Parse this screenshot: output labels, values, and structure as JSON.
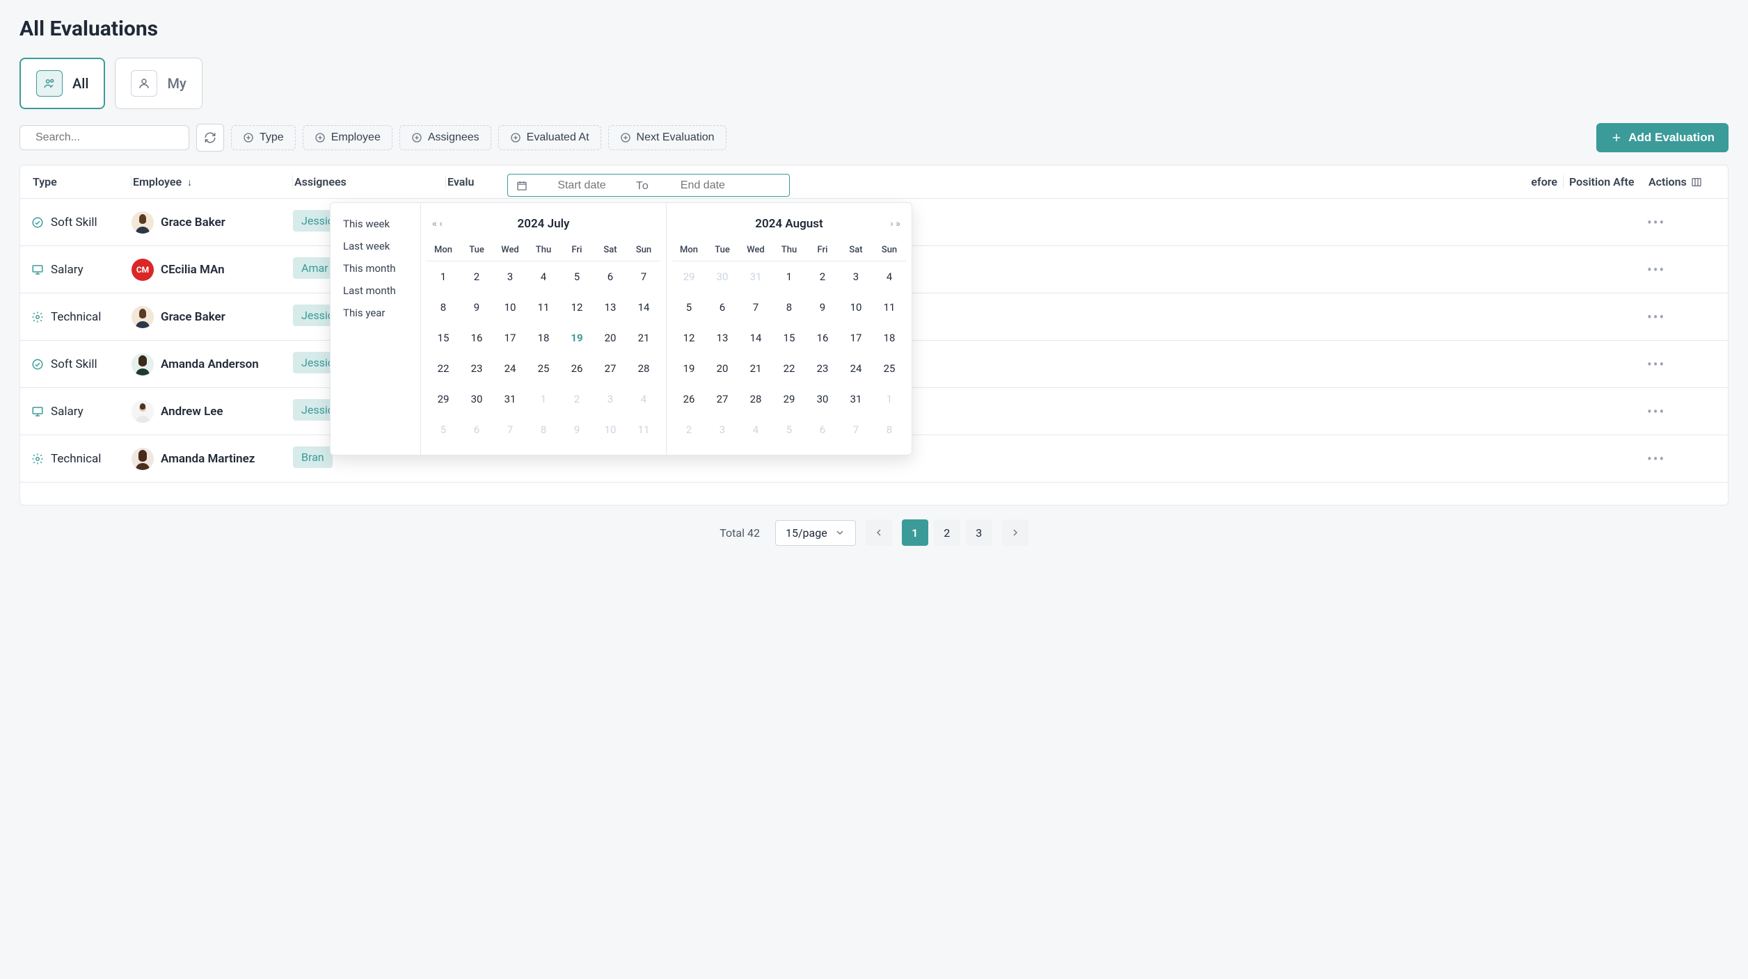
{
  "page_title": "All Evaluations",
  "tabs": {
    "all": "All",
    "my": "My"
  },
  "search": {
    "placeholder": "Search..."
  },
  "filters": {
    "type": "Type",
    "employee": "Employee",
    "assignees": "Assignees",
    "evaluated_at": "Evaluated At",
    "next_evaluation": "Next Evaluation"
  },
  "add_button": "Add Evaluation",
  "columns": {
    "type": "Type",
    "employee": "Employee",
    "assignees": "Assignees",
    "evaluated_at": "Evaluated At",
    "position_before": "Position Before",
    "position_after": "Position After",
    "actions": "Actions"
  },
  "column_cutoffs": {
    "evaluated_at": "Evalu",
    "position_before": "efore",
    "position_after": "Position Afte"
  },
  "rows": [
    {
      "type": "Soft Skill",
      "type_icon": "check-circle",
      "employee": "Grace Baker",
      "avatar": "photo-f1",
      "assignee": "Jessica",
      "assignee_cut": "Jessic"
    },
    {
      "type": "Salary",
      "type_icon": "monitor",
      "employee": "CEcilia MAn",
      "avatar": "initials",
      "initials": "CM",
      "assignee": "Amar",
      "assignee_cut": "Amar"
    },
    {
      "type": "Technical",
      "type_icon": "gear",
      "employee": "Grace Baker",
      "avatar": "photo-f1",
      "assignee": "Jessica",
      "assignee_cut": "Jessic"
    },
    {
      "type": "Soft Skill",
      "type_icon": "check-circle",
      "employee": "Amanda Anderson",
      "avatar": "photo-f2",
      "assignee": "Jessica",
      "assignee_cut": "Jessic"
    },
    {
      "type": "Salary",
      "type_icon": "monitor",
      "employee": "Andrew Lee",
      "avatar": "photo-m1",
      "assignee": "Jessica",
      "assignee_cut": "Jessic"
    },
    {
      "type": "Technical",
      "type_icon": "gear",
      "employee": "Amanda Martinez",
      "avatar": "photo-f3",
      "assignee": "Bran",
      "assignee_cut": "Bran"
    }
  ],
  "date_picker": {
    "start_placeholder": "Start date",
    "end_placeholder": "End date",
    "to": "To",
    "quick": [
      "This week",
      "Last week",
      "This month",
      "Last month",
      "This year"
    ],
    "left": {
      "title": "2024 July",
      "weekdays": [
        "Mon",
        "Tue",
        "Wed",
        "Thu",
        "Fri",
        "Sat",
        "Sun"
      ],
      "today": 19,
      "weeks": [
        [
          {
            "d": 1
          },
          {
            "d": 2
          },
          {
            "d": 3
          },
          {
            "d": 4
          },
          {
            "d": 5
          },
          {
            "d": 6
          },
          {
            "d": 7
          }
        ],
        [
          {
            "d": 8
          },
          {
            "d": 9
          },
          {
            "d": 10
          },
          {
            "d": 11
          },
          {
            "d": 12
          },
          {
            "d": 13
          },
          {
            "d": 14
          }
        ],
        [
          {
            "d": 15
          },
          {
            "d": 16
          },
          {
            "d": 17
          },
          {
            "d": 18
          },
          {
            "d": 19,
            "today": true
          },
          {
            "d": 20
          },
          {
            "d": 21
          }
        ],
        [
          {
            "d": 22
          },
          {
            "d": 23
          },
          {
            "d": 24
          },
          {
            "d": 25
          },
          {
            "d": 26
          },
          {
            "d": 27
          },
          {
            "d": 28
          }
        ],
        [
          {
            "d": 29
          },
          {
            "d": 30
          },
          {
            "d": 31
          },
          {
            "d": 1,
            "muted": true
          },
          {
            "d": 2,
            "muted": true
          },
          {
            "d": 3,
            "muted": true
          },
          {
            "d": 4,
            "muted": true
          }
        ],
        [
          {
            "d": 5,
            "muted": true
          },
          {
            "d": 6,
            "muted": true
          },
          {
            "d": 7,
            "muted": true
          },
          {
            "d": 8,
            "muted": true
          },
          {
            "d": 9,
            "muted": true
          },
          {
            "d": 10,
            "muted": true
          },
          {
            "d": 11,
            "muted": true
          }
        ]
      ]
    },
    "right": {
      "title": "2024 August",
      "weekdays": [
        "Mon",
        "Tue",
        "Wed",
        "Thu",
        "Fri",
        "Sat",
        "Sun"
      ],
      "weeks": [
        [
          {
            "d": 29,
            "muted": true
          },
          {
            "d": 30,
            "muted": true
          },
          {
            "d": 31,
            "muted": true
          },
          {
            "d": 1
          },
          {
            "d": 2
          },
          {
            "d": 3
          },
          {
            "d": 4
          }
        ],
        [
          {
            "d": 5
          },
          {
            "d": 6
          },
          {
            "d": 7
          },
          {
            "d": 8
          },
          {
            "d": 9
          },
          {
            "d": 10
          },
          {
            "d": 11
          }
        ],
        [
          {
            "d": 12
          },
          {
            "d": 13
          },
          {
            "d": 14
          },
          {
            "d": 15
          },
          {
            "d": 16
          },
          {
            "d": 17
          },
          {
            "d": 18
          }
        ],
        [
          {
            "d": 19
          },
          {
            "d": 20
          },
          {
            "d": 21
          },
          {
            "d": 22
          },
          {
            "d": 23
          },
          {
            "d": 24
          },
          {
            "d": 25
          }
        ],
        [
          {
            "d": 26
          },
          {
            "d": 27
          },
          {
            "d": 28
          },
          {
            "d": 29
          },
          {
            "d": 30
          },
          {
            "d": 31
          },
          {
            "d": 1,
            "muted": true
          }
        ],
        [
          {
            "d": 2,
            "muted": true
          },
          {
            "d": 3,
            "muted": true
          },
          {
            "d": 4,
            "muted": true
          },
          {
            "d": 5,
            "muted": true
          },
          {
            "d": 6,
            "muted": true
          },
          {
            "d": 7,
            "muted": true
          },
          {
            "d": 8,
            "muted": true
          }
        ]
      ]
    }
  },
  "pagination": {
    "total_label": "Total 42",
    "page_size": "15/page",
    "pages": [
      "1",
      "2",
      "3"
    ],
    "current": "1"
  },
  "colors": {
    "accent": "#3a9b99"
  }
}
